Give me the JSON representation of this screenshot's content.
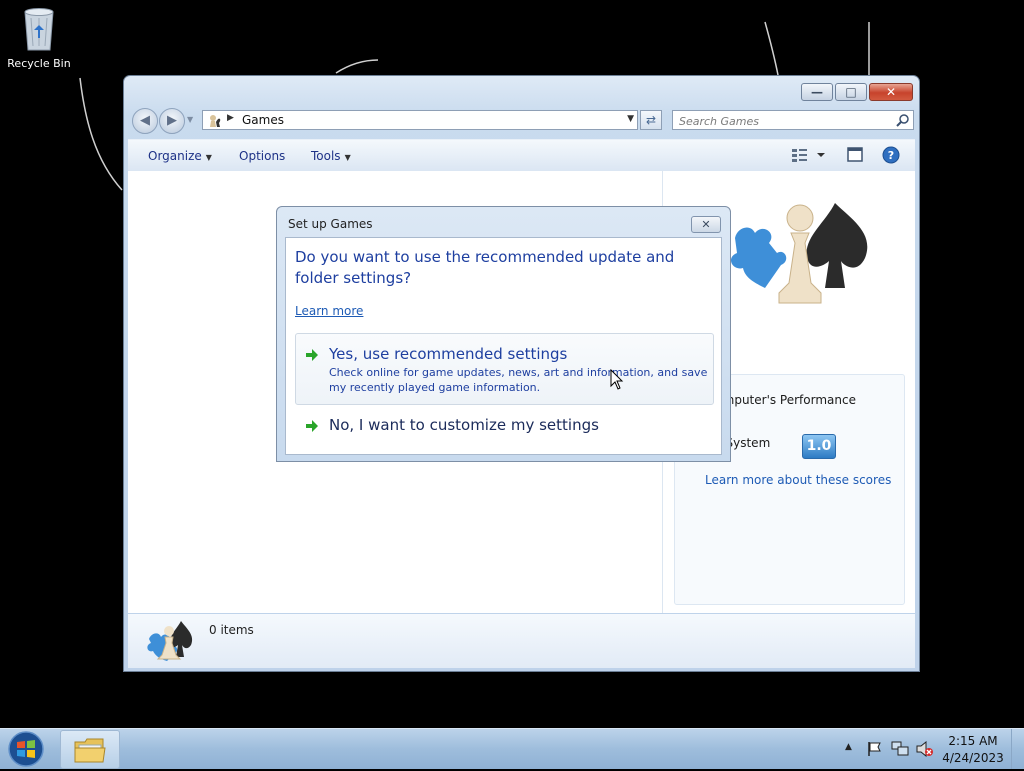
{
  "desktop": {
    "recycle_bin_label": "Recycle Bin"
  },
  "window": {
    "breadcrumb": "Games",
    "search_placeholder": "Search Games",
    "toolbar": {
      "organize": "Organize",
      "options": "Options",
      "tools": "Tools"
    },
    "performance": {
      "text": "our computer's Performance\ntion:",
      "current_system_label": "urrent System",
      "score": "1.0",
      "learn_more_scores": "Learn more about these scores"
    },
    "details": {
      "item_count": "0 items"
    }
  },
  "dialog": {
    "title": "Set up Games",
    "question": "Do you want to use the recommended update and folder settings?",
    "learn_more": "Learn more",
    "option_yes": {
      "heading": "Yes, use recommended settings",
      "description": "Check online for game updates, news, art and information, and save my recently played game information."
    },
    "option_no": {
      "heading": "No, I want to customize my settings"
    }
  },
  "taskbar": {
    "time": "2:15 AM",
    "date": "4/24/2023"
  },
  "colors": {
    "link": "#1e5bb5",
    "dialog_heading": "#1e3fa0",
    "arrow_green": "#2aa52a"
  },
  "icons": [
    "recycle-bin-icon",
    "back-icon",
    "forward-icon",
    "games-icon",
    "search-icon",
    "refresh-icon",
    "view-icon",
    "preview-pane-icon",
    "help-icon",
    "green-arrow-icon",
    "start-orb-icon",
    "explorer-icon",
    "flag-icon",
    "network-icon",
    "volume-muted-icon",
    "cursor-icon"
  ]
}
